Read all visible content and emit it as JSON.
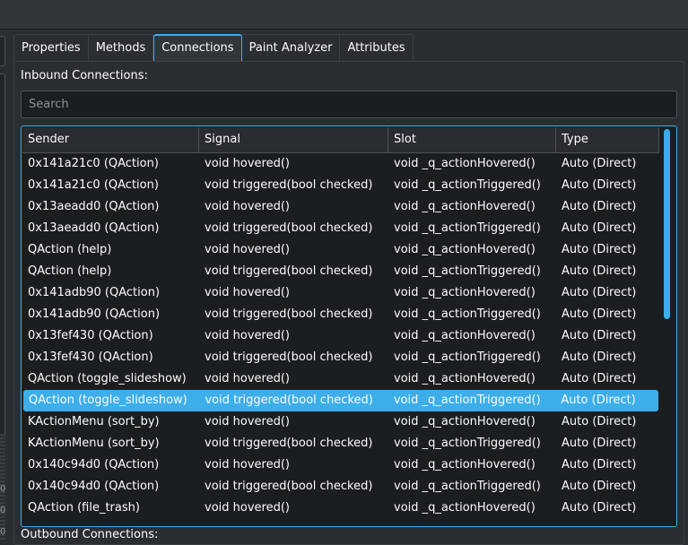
{
  "tabs": [
    "Properties",
    "Methods",
    "Connections",
    "Paint Analyzer",
    "Attributes"
  ],
  "active_tab": "Connections",
  "inbound": {
    "label": "Inbound Connections:",
    "search_placeholder": "Search",
    "columns": [
      "Sender",
      "Signal",
      "Slot",
      "Type"
    ],
    "selected_row": 11,
    "rows": [
      [
        "0x141a21c0 (QAction)",
        "void hovered()",
        "void _q_actionHovered()",
        "Auto (Direct)"
      ],
      [
        "0x141a21c0 (QAction)",
        "void triggered(bool checked)",
        "void _q_actionTriggered()",
        "Auto (Direct)"
      ],
      [
        "0x13aeadd0 (QAction)",
        "void hovered()",
        "void _q_actionHovered()",
        "Auto (Direct)"
      ],
      [
        "0x13aeadd0 (QAction)",
        "void triggered(bool checked)",
        "void _q_actionTriggered()",
        "Auto (Direct)"
      ],
      [
        "QAction (help)",
        "void hovered()",
        "void _q_actionHovered()",
        "Auto (Direct)"
      ],
      [
        "QAction (help)",
        "void triggered(bool checked)",
        "void _q_actionTriggered()",
        "Auto (Direct)"
      ],
      [
        "0x141adb90 (QAction)",
        "void hovered()",
        "void _q_actionHovered()",
        "Auto (Direct)"
      ],
      [
        "0x141adb90 (QAction)",
        "void triggered(bool checked)",
        "void _q_actionTriggered()",
        "Auto (Direct)"
      ],
      [
        "0x13fef430 (QAction)",
        "void hovered()",
        "void _q_actionHovered()",
        "Auto (Direct)"
      ],
      [
        "0x13fef430 (QAction)",
        "void triggered(bool checked)",
        "void _q_actionTriggered()",
        "Auto (Direct)"
      ],
      [
        "QAction (toggle_slideshow)",
        "void hovered()",
        "void _q_actionHovered()",
        "Auto (Direct)"
      ],
      [
        "QAction (toggle_slideshow)",
        "void triggered(bool checked)",
        "void _q_actionTriggered()",
        "Auto (Direct)"
      ],
      [
        "KActionMenu (sort_by)",
        "void hovered()",
        "void _q_actionHovered()",
        "Auto (Direct)"
      ],
      [
        "KActionMenu (sort_by)",
        "void triggered(bool checked)",
        "void _q_actionTriggered()",
        "Auto (Direct)"
      ],
      [
        "0x140c94d0 (QAction)",
        "void hovered()",
        "void _q_actionHovered()",
        "Auto (Direct)"
      ],
      [
        "0x140c94d0 (QAction)",
        "void triggered(bool checked)",
        "void _q_actionTriggered()",
        "Auto (Direct)"
      ],
      [
        "QAction (file_trash)",
        "void hovered()",
        "void _q_actionHovered()",
        "Auto (Direct)"
      ]
    ]
  },
  "outbound": {
    "label": "Outbound Connections:"
  },
  "left_digits": [
    "0",
    "0",
    "0"
  ],
  "colors": {
    "accent": "#3daee9",
    "background": "#2a2e32",
    "view_bg": "#1b1e20"
  }
}
